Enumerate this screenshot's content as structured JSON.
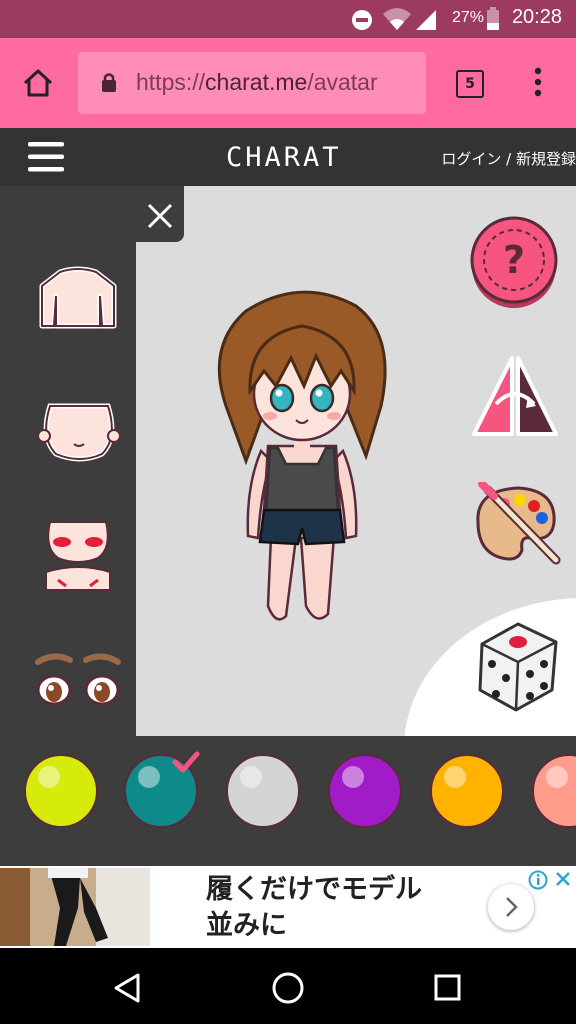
{
  "status_bar": {
    "battery_percent": "27%",
    "time": "20:28",
    "icons": [
      "do-not-disturb-icon",
      "wifi-icon",
      "signal-icon",
      "battery-icon"
    ]
  },
  "browser": {
    "url_scheme": "https://",
    "url_host": "charat.me",
    "url_path": "/avatar",
    "tab_count": "5",
    "icons": [
      "home-icon",
      "lock-icon",
      "more-icon"
    ]
  },
  "site_header": {
    "logo": "CHARAT",
    "login_link": "ログイン / 新規登録"
  },
  "parts": [
    "body-part",
    "head-part",
    "face-blush-part",
    "eyes-eyebrows-part"
  ],
  "colors": {
    "selected_index": 1,
    "swatches": [
      "#d6ea0c",
      "#0f8a8a",
      "#d4d4d4",
      "#a21bc9",
      "#ffb300",
      "#ff9c8c"
    ]
  },
  "tools": [
    "help-icon",
    "flip-icon",
    "palette-icon",
    "dice-icon"
  ],
  "ad": {
    "line1": "履くだけでモデル",
    "line2": "並みに"
  },
  "nav": [
    "back-icon",
    "home-nav-icon",
    "recents-icon"
  ]
}
